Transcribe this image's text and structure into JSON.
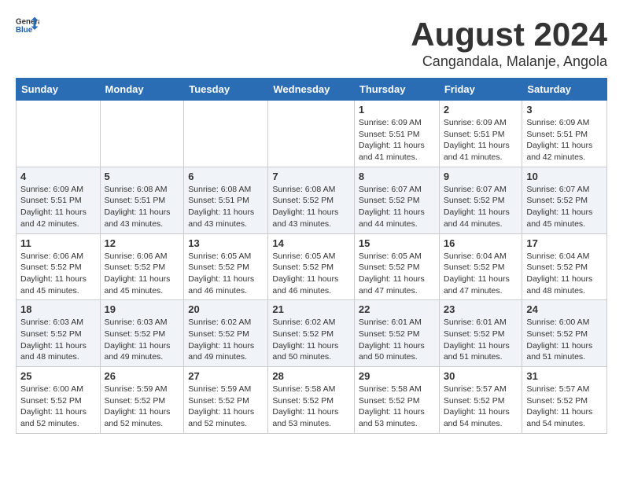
{
  "header": {
    "logo_general": "General",
    "logo_blue": "Blue",
    "title": "August 2024",
    "subtitle": "Cangandala, Malanje, Angola"
  },
  "calendar": {
    "days_of_week": [
      "Sunday",
      "Monday",
      "Tuesday",
      "Wednesday",
      "Thursday",
      "Friday",
      "Saturday"
    ],
    "weeks": [
      {
        "row_class": "week-row-1",
        "days": [
          {
            "number": "",
            "info": ""
          },
          {
            "number": "",
            "info": ""
          },
          {
            "number": "",
            "info": ""
          },
          {
            "number": "",
            "info": ""
          },
          {
            "number": "1",
            "info": "Sunrise: 6:09 AM\nSunset: 5:51 PM\nDaylight: 11 hours\nand 41 minutes."
          },
          {
            "number": "2",
            "info": "Sunrise: 6:09 AM\nSunset: 5:51 PM\nDaylight: 11 hours\nand 41 minutes."
          },
          {
            "number": "3",
            "info": "Sunrise: 6:09 AM\nSunset: 5:51 PM\nDaylight: 11 hours\nand 42 minutes."
          }
        ]
      },
      {
        "row_class": "week-row-2",
        "days": [
          {
            "number": "4",
            "info": "Sunrise: 6:09 AM\nSunset: 5:51 PM\nDaylight: 11 hours\nand 42 minutes."
          },
          {
            "number": "5",
            "info": "Sunrise: 6:08 AM\nSunset: 5:51 PM\nDaylight: 11 hours\nand 43 minutes."
          },
          {
            "number": "6",
            "info": "Sunrise: 6:08 AM\nSunset: 5:51 PM\nDaylight: 11 hours\nand 43 minutes."
          },
          {
            "number": "7",
            "info": "Sunrise: 6:08 AM\nSunset: 5:52 PM\nDaylight: 11 hours\nand 43 minutes."
          },
          {
            "number": "8",
            "info": "Sunrise: 6:07 AM\nSunset: 5:52 PM\nDaylight: 11 hours\nand 44 minutes."
          },
          {
            "number": "9",
            "info": "Sunrise: 6:07 AM\nSunset: 5:52 PM\nDaylight: 11 hours\nand 44 minutes."
          },
          {
            "number": "10",
            "info": "Sunrise: 6:07 AM\nSunset: 5:52 PM\nDaylight: 11 hours\nand 45 minutes."
          }
        ]
      },
      {
        "row_class": "week-row-3",
        "days": [
          {
            "number": "11",
            "info": "Sunrise: 6:06 AM\nSunset: 5:52 PM\nDaylight: 11 hours\nand 45 minutes."
          },
          {
            "number": "12",
            "info": "Sunrise: 6:06 AM\nSunset: 5:52 PM\nDaylight: 11 hours\nand 45 minutes."
          },
          {
            "number": "13",
            "info": "Sunrise: 6:05 AM\nSunset: 5:52 PM\nDaylight: 11 hours\nand 46 minutes."
          },
          {
            "number": "14",
            "info": "Sunrise: 6:05 AM\nSunset: 5:52 PM\nDaylight: 11 hours\nand 46 minutes."
          },
          {
            "number": "15",
            "info": "Sunrise: 6:05 AM\nSunset: 5:52 PM\nDaylight: 11 hours\nand 47 minutes."
          },
          {
            "number": "16",
            "info": "Sunrise: 6:04 AM\nSunset: 5:52 PM\nDaylight: 11 hours\nand 47 minutes."
          },
          {
            "number": "17",
            "info": "Sunrise: 6:04 AM\nSunset: 5:52 PM\nDaylight: 11 hours\nand 48 minutes."
          }
        ]
      },
      {
        "row_class": "week-row-4",
        "days": [
          {
            "number": "18",
            "info": "Sunrise: 6:03 AM\nSunset: 5:52 PM\nDaylight: 11 hours\nand 48 minutes."
          },
          {
            "number": "19",
            "info": "Sunrise: 6:03 AM\nSunset: 5:52 PM\nDaylight: 11 hours\nand 49 minutes."
          },
          {
            "number": "20",
            "info": "Sunrise: 6:02 AM\nSunset: 5:52 PM\nDaylight: 11 hours\nand 49 minutes."
          },
          {
            "number": "21",
            "info": "Sunrise: 6:02 AM\nSunset: 5:52 PM\nDaylight: 11 hours\nand 50 minutes."
          },
          {
            "number": "22",
            "info": "Sunrise: 6:01 AM\nSunset: 5:52 PM\nDaylight: 11 hours\nand 50 minutes."
          },
          {
            "number": "23",
            "info": "Sunrise: 6:01 AM\nSunset: 5:52 PM\nDaylight: 11 hours\nand 51 minutes."
          },
          {
            "number": "24",
            "info": "Sunrise: 6:00 AM\nSunset: 5:52 PM\nDaylight: 11 hours\nand 51 minutes."
          }
        ]
      },
      {
        "row_class": "week-row-5",
        "days": [
          {
            "number": "25",
            "info": "Sunrise: 6:00 AM\nSunset: 5:52 PM\nDaylight: 11 hours\nand 52 minutes."
          },
          {
            "number": "26",
            "info": "Sunrise: 5:59 AM\nSunset: 5:52 PM\nDaylight: 11 hours\nand 52 minutes."
          },
          {
            "number": "27",
            "info": "Sunrise: 5:59 AM\nSunset: 5:52 PM\nDaylight: 11 hours\nand 52 minutes."
          },
          {
            "number": "28",
            "info": "Sunrise: 5:58 AM\nSunset: 5:52 PM\nDaylight: 11 hours\nand 53 minutes."
          },
          {
            "number": "29",
            "info": "Sunrise: 5:58 AM\nSunset: 5:52 PM\nDaylight: 11 hours\nand 53 minutes."
          },
          {
            "number": "30",
            "info": "Sunrise: 5:57 AM\nSunset: 5:52 PM\nDaylight: 11 hours\nand 54 minutes."
          },
          {
            "number": "31",
            "info": "Sunrise: 5:57 AM\nSunset: 5:52 PM\nDaylight: 11 hours\nand 54 minutes."
          }
        ]
      }
    ]
  }
}
